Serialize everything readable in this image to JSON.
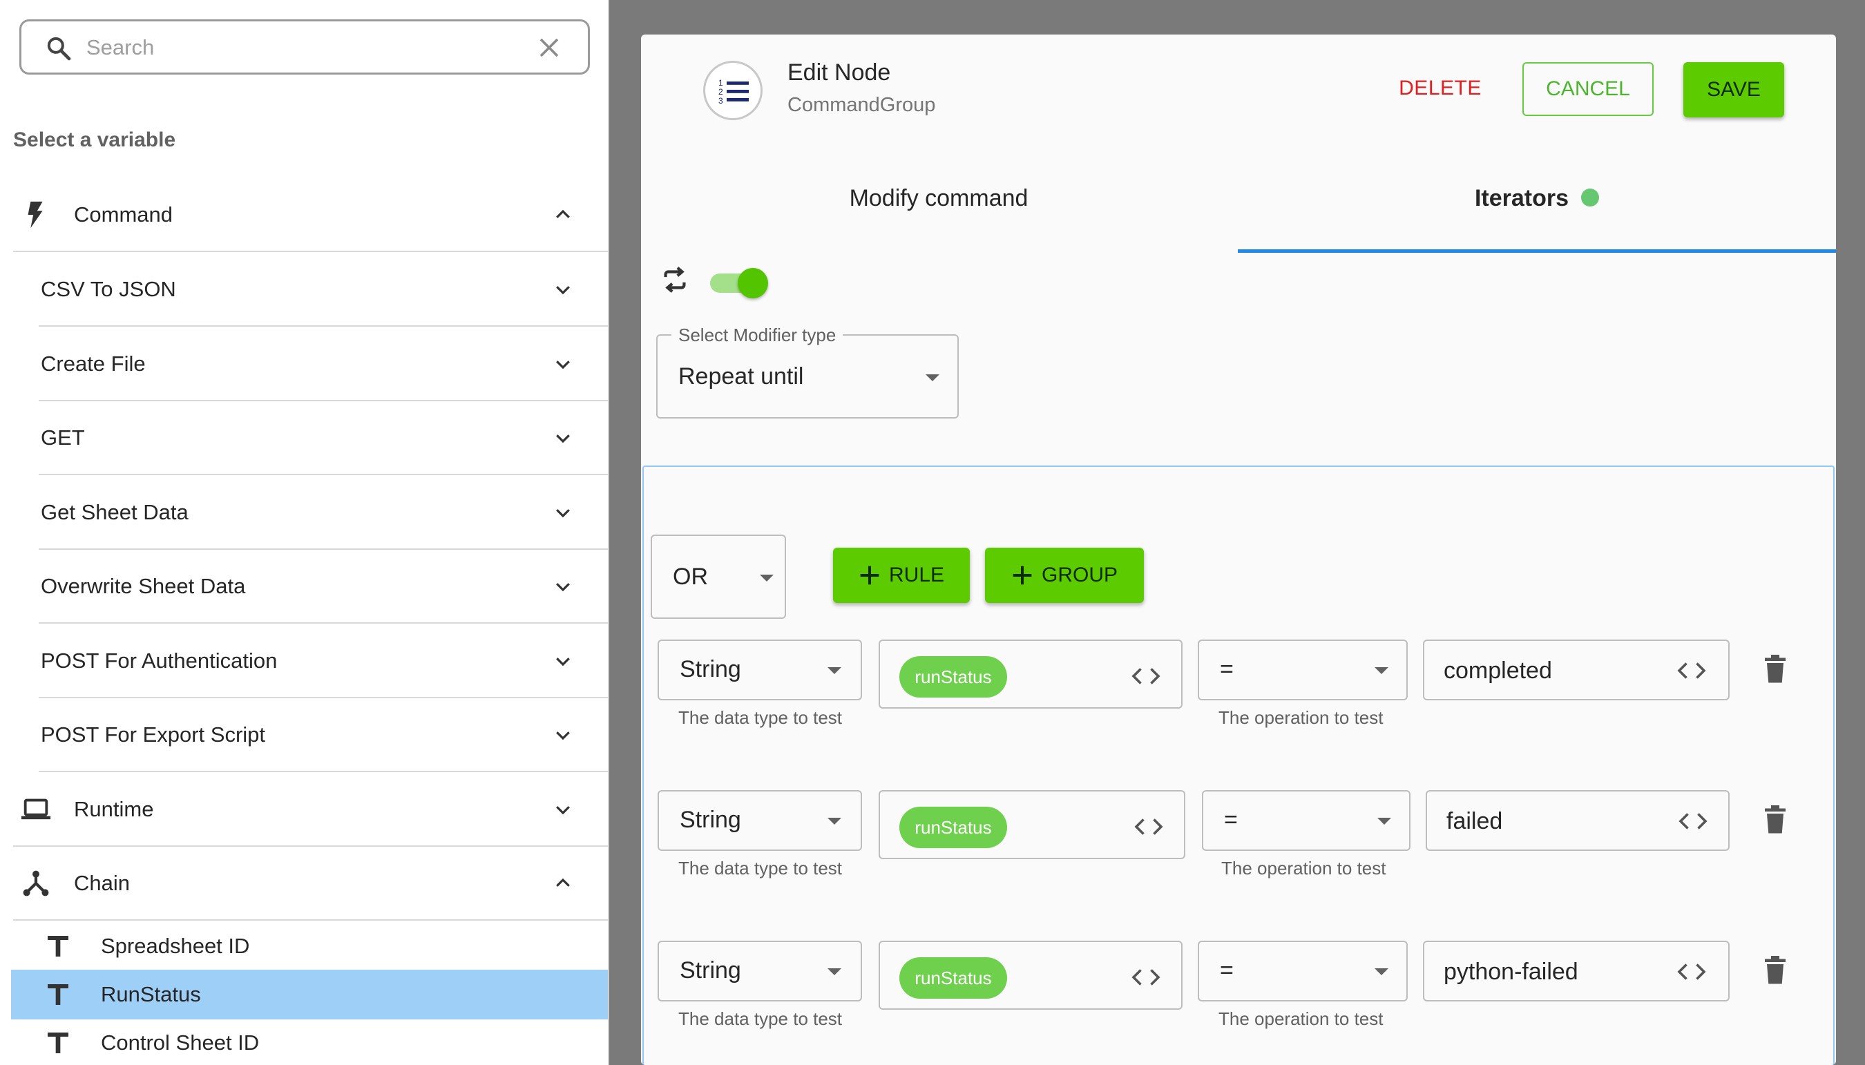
{
  "search": {
    "placeholder": "Search"
  },
  "sidebar": {
    "heading": "Select a variable",
    "categories": {
      "command": "Command",
      "runtime": "Runtime",
      "chain": "Chain"
    },
    "command_items": [
      "CSV To JSON",
      "Create File",
      "GET",
      "Get Sheet Data",
      "Overwrite Sheet Data",
      "POST For Authentication",
      "POST For Export Script"
    ],
    "chain_items": [
      "Spreadsheet ID",
      "RunStatus",
      "Control Sheet ID"
    ],
    "selected_item": "RunStatus",
    "selected_color": "#9ed0f7"
  },
  "modal": {
    "title": "Edit Node",
    "subtitle": "CommandGroup",
    "delete_label": "DELETE",
    "cancel_label": "CANCEL",
    "save_label": "SAVE",
    "tabs": {
      "modify": "Modify command",
      "iterators": "Iterators"
    },
    "active_tab": "Iterators",
    "toggle_on": true,
    "modifier": {
      "legend": "Select Modifier type",
      "value": "Repeat until"
    },
    "query": {
      "combinator": "OR",
      "add_rule_label": "RULE",
      "add_group_label": "GROUP",
      "rules": [
        {
          "data_type": "String",
          "data_type_helper": "The data type to test",
          "variable": "runStatus",
          "operator": "=",
          "operator_helper": "The operation to test",
          "value": "completed"
        },
        {
          "data_type": "String",
          "data_type_helper": "The data type to test",
          "variable": "runStatus",
          "operator": "=",
          "operator_helper": "The operation to test",
          "value": "failed"
        },
        {
          "data_type": "String",
          "data_type_helper": "The data type to test",
          "variable": "runStatus",
          "operator": "=",
          "operator_helper": "The operation to test",
          "value": "python-failed"
        }
      ]
    }
  },
  "colors": {
    "accent_green": "#5ccc00",
    "danger": "#e02020",
    "tab_indicator": "#1e88e5",
    "status_dot": "#66c771"
  }
}
